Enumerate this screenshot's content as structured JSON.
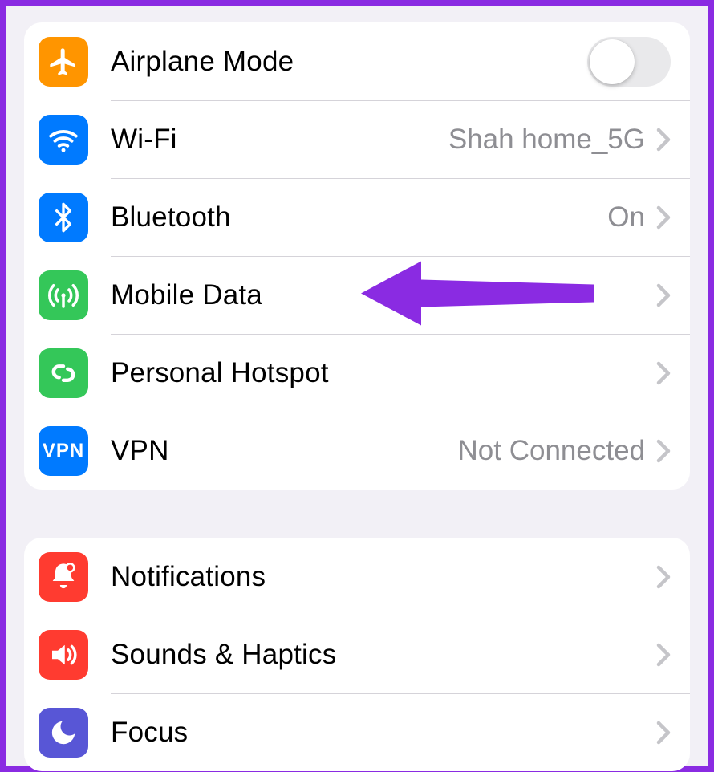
{
  "group1": {
    "airplane": {
      "label": "Airplane Mode",
      "toggle": false,
      "icon_color": "#ff9500"
    },
    "wifi": {
      "label": "Wi-Fi",
      "value": "Shah home_5G",
      "icon_color": "#007aff"
    },
    "bluetooth": {
      "label": "Bluetooth",
      "value": "On",
      "icon_color": "#007aff"
    },
    "mobile_data": {
      "label": "Mobile Data",
      "icon_color": "#34c759"
    },
    "hotspot": {
      "label": "Personal Hotspot",
      "icon_color": "#34c759"
    },
    "vpn": {
      "label": "VPN",
      "value": "Not Connected",
      "icon_text": "VPN",
      "icon_color": "#007aff"
    }
  },
  "group2": {
    "notifications": {
      "label": "Notifications",
      "icon_color": "#ff3b30"
    },
    "sounds": {
      "label": "Sounds & Haptics",
      "icon_color": "#ff3b30"
    },
    "focus": {
      "label": "Focus",
      "icon_color": "#5856d6"
    }
  },
  "annotation_arrow_color": "#8a2be2"
}
